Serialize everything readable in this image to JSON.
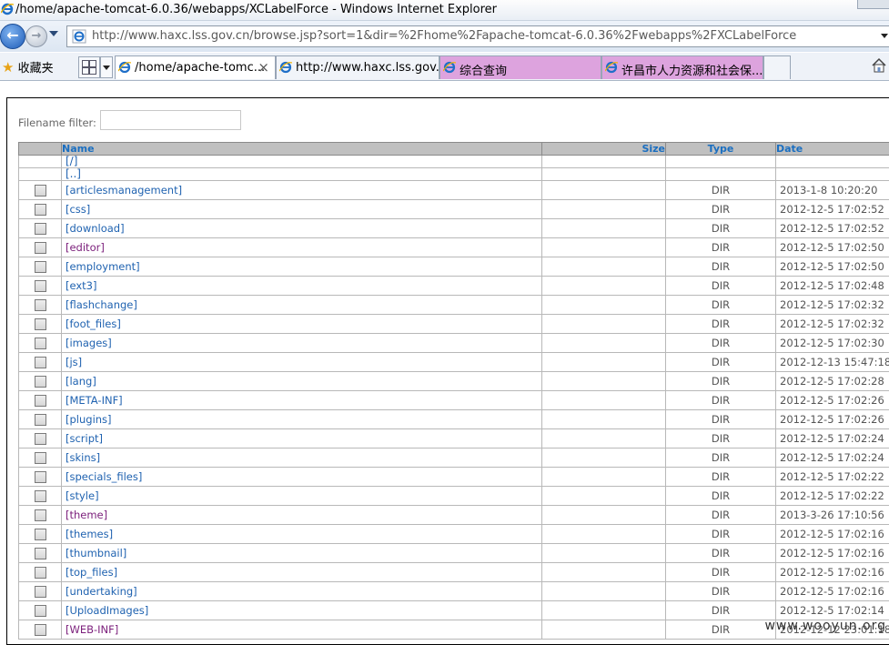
{
  "window": {
    "title": "/home/apache-tomcat-6.0.36/webapps/XCLabelForce - Windows Internet Explorer"
  },
  "address": {
    "url": "http://www.haxc.lss.gov.cn/browse.jsp?sort=1&dir=%2Fhome%2Fapache-tomcat-6.0.36%2Fwebapps%2FXCLabelForce"
  },
  "favorites": {
    "label": "收藏夹"
  },
  "tabs": [
    {
      "label": "/home/apache-tomc...",
      "active": true,
      "close": "×"
    },
    {
      "label": "http://www.haxc.lss.gov...."
    },
    {
      "label": "综合查询",
      "color": "#dda3de"
    },
    {
      "label": "许昌市人力资源和社会保...",
      "color": "#dda3de"
    }
  ],
  "filter": {
    "label": "Filename filter:",
    "value": ""
  },
  "table": {
    "headers": {
      "name": "Name",
      "size": "Size",
      "type": "Type",
      "date": "Date"
    },
    "up_links": [
      "[/]",
      "[..]"
    ],
    "rows": [
      {
        "name": "[articlesmanagement]",
        "type": "DIR",
        "date": "2013-1-8 10:20:20",
        "visited": false
      },
      {
        "name": "[css]",
        "type": "DIR",
        "date": "2012-12-5 17:02:52",
        "visited": false
      },
      {
        "name": "[download]",
        "type": "DIR",
        "date": "2012-12-5 17:02:52",
        "visited": false
      },
      {
        "name": "[editor]",
        "type": "DIR",
        "date": "2012-12-5 17:02:50",
        "visited": true
      },
      {
        "name": "[employment]",
        "type": "DIR",
        "date": "2012-12-5 17:02:50",
        "visited": false
      },
      {
        "name": "[ext3]",
        "type": "DIR",
        "date": "2012-12-5 17:02:48",
        "visited": false
      },
      {
        "name": "[flashchange]",
        "type": "DIR",
        "date": "2012-12-5 17:02:32",
        "visited": false
      },
      {
        "name": "[foot_files]",
        "type": "DIR",
        "date": "2012-12-5 17:02:32",
        "visited": false
      },
      {
        "name": "[images]",
        "type": "DIR",
        "date": "2012-12-5 17:02:30",
        "visited": false
      },
      {
        "name": "[js]",
        "type": "DIR",
        "date": "2012-12-13 15:47:18",
        "visited": false
      },
      {
        "name": "[lang]",
        "type": "DIR",
        "date": "2012-12-5 17:02:28",
        "visited": false
      },
      {
        "name": "[META-INF]",
        "type": "DIR",
        "date": "2012-12-5 17:02:26",
        "visited": false
      },
      {
        "name": "[plugins]",
        "type": "DIR",
        "date": "2012-12-5 17:02:26",
        "visited": false
      },
      {
        "name": "[script]",
        "type": "DIR",
        "date": "2012-12-5 17:02:24",
        "visited": false
      },
      {
        "name": "[skins]",
        "type": "DIR",
        "date": "2012-12-5 17:02:24",
        "visited": false
      },
      {
        "name": "[specials_files]",
        "type": "DIR",
        "date": "2012-12-5 17:02:22",
        "visited": false
      },
      {
        "name": "[style]",
        "type": "DIR",
        "date": "2012-12-5 17:02:22",
        "visited": false
      },
      {
        "name": "[theme]",
        "type": "DIR",
        "date": "2013-3-26 17:10:56",
        "visited": true
      },
      {
        "name": "[themes]",
        "type": "DIR",
        "date": "2012-12-5 17:02:16",
        "visited": false
      },
      {
        "name": "[thumbnail]",
        "type": "DIR",
        "date": "2012-12-5 17:02:16",
        "visited": false
      },
      {
        "name": "[top_files]",
        "type": "DIR",
        "date": "2012-12-5 17:02:16",
        "visited": false
      },
      {
        "name": "[undertaking]",
        "type": "DIR",
        "date": "2012-12-5 17:02:16",
        "visited": false
      },
      {
        "name": "[UploadImages]",
        "type": "DIR",
        "date": "2012-12-5 17:02:14",
        "visited": false
      },
      {
        "name": "[WEB-INF]",
        "type": "DIR",
        "date": "2012-12-12 23:01:18",
        "visited": true
      }
    ]
  },
  "watermark": "www.wooyun.org",
  "icons": {
    "browser": "ie-icon",
    "home": "home-icon",
    "favorites": "star-icon"
  }
}
